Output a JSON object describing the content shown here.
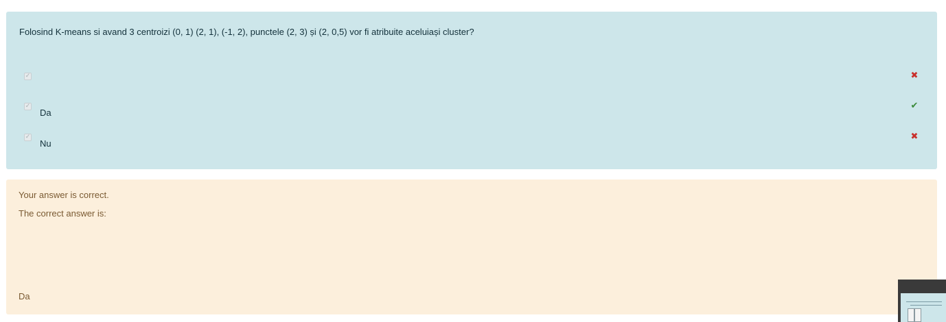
{
  "question": {
    "text": "Folosind K-means si avand 3 centroizi (0, 1) (2, 1), (-1, 2), punctele (2, 3) și (2, 0,5) vor fi atribuite aceluiași cluster?",
    "options": [
      {
        "label": "",
        "checked": true,
        "disabled": true,
        "mark": "wrong",
        "mark_glyph": "✖"
      },
      {
        "label": "Da",
        "checked": true,
        "disabled": true,
        "mark": "right",
        "mark_glyph": "✔"
      },
      {
        "label": "Nu",
        "checked": true,
        "disabled": true,
        "mark": "wrong",
        "mark_glyph": "✖"
      }
    ]
  },
  "feedback": {
    "status": "Your answer is correct.",
    "correct_intro": "The correct answer is:",
    "correct_answer": "Da"
  },
  "colors": {
    "question_bg": "#cde6ea",
    "feedback_bg": "#fcefdc",
    "wrong_mark": "#c9302c",
    "right_mark": "#3a8a3a"
  },
  "icons": {
    "checkbox": "checkbox-checked-disabled-icon",
    "wrong": "cross-icon",
    "right": "check-icon"
  }
}
